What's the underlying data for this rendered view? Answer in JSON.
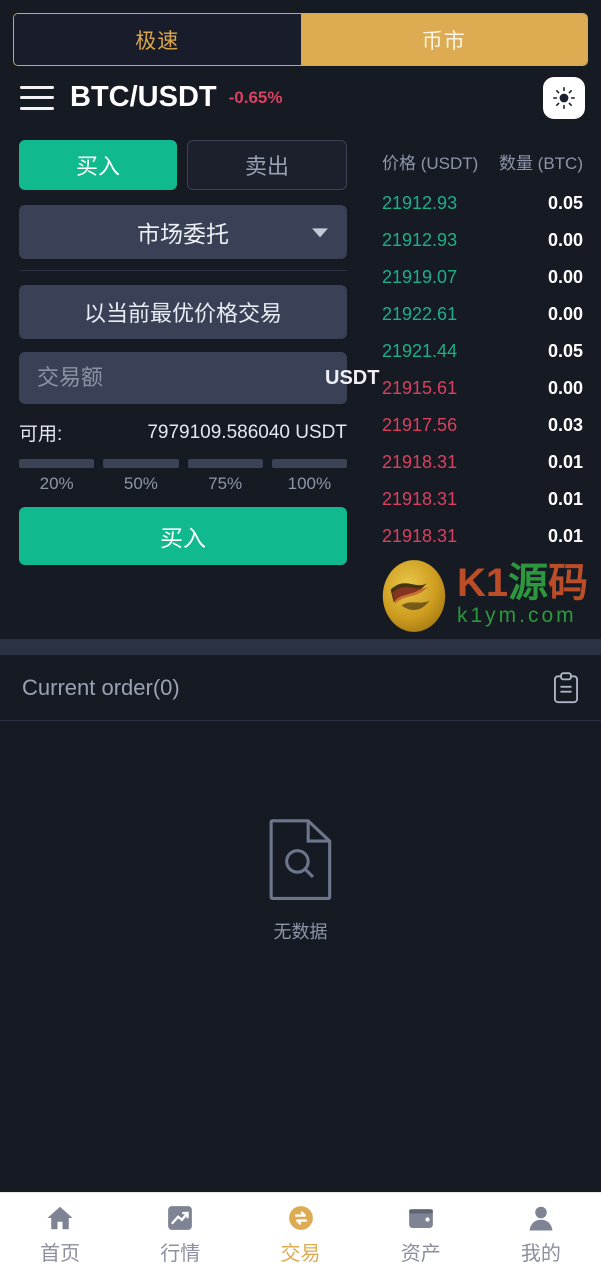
{
  "top_tabs": [
    {
      "label": "极速",
      "active": false
    },
    {
      "label": "币市",
      "active": true
    }
  ],
  "header": {
    "menu_icon": "hamburger-menu-icon",
    "pair": "BTC/USDT",
    "change": "-0.65%",
    "change_color": "#d9415f",
    "theme_icon": "sun-icon"
  },
  "order_form": {
    "side_buy_label": "买入",
    "side_sell_label": "卖出",
    "active_side": "buy",
    "order_type_label": "市场委托",
    "order_type_caret_icon": "chevron-down-icon",
    "best_price_label": "以当前最优价格交易",
    "amount_placeholder": "交易额",
    "amount_value": "",
    "amount_unit": "USDT",
    "available_label": "可用:",
    "available_value": "7979109.586040 USDT",
    "percents": [
      "20%",
      "50%",
      "75%",
      "100%"
    ],
    "submit_label": "买入"
  },
  "order_book": {
    "col_price": "价格 (USDT)",
    "col_amount": "数量 (BTC)",
    "rows": [
      {
        "price": "21912.93",
        "amount": "0.05",
        "side": "bid"
      },
      {
        "price": "21912.93",
        "amount": "0.00",
        "side": "bid"
      },
      {
        "price": "21919.07",
        "amount": "0.00",
        "side": "bid"
      },
      {
        "price": "21922.61",
        "amount": "0.00",
        "side": "bid"
      },
      {
        "price": "21921.44",
        "amount": "0.05",
        "side": "bid"
      },
      {
        "price": "21915.61",
        "amount": "0.00",
        "side": "ask"
      },
      {
        "price": "21917.56",
        "amount": "0.03",
        "side": "ask"
      },
      {
        "price": "21918.31",
        "amount": "0.01",
        "side": "ask"
      },
      {
        "price": "21918.31",
        "amount": "0.01",
        "side": "ask"
      },
      {
        "price": "21918.31",
        "amount": "0.01",
        "side": "ask"
      }
    ],
    "bid_color": "#1eae8c",
    "ask_color": "#d9415f"
  },
  "watermark": {
    "logo_icon": "yin-yang-logo-icon",
    "text_k1": "K1",
    "text_cn1": "源",
    "text_cn2": "码",
    "text_sub": "k1ym.com"
  },
  "current_order": {
    "title": "Current order(0)",
    "clipboard_icon": "clipboard-icon",
    "empty_icon": "document-search-icon",
    "empty_text": "无数据"
  },
  "bottom_nav": [
    {
      "label": "首页",
      "icon": "home-icon",
      "active": false
    },
    {
      "label": "行情",
      "icon": "chart-trend-icon",
      "active": false
    },
    {
      "label": "交易",
      "icon": "exchange-coin-icon",
      "active": true
    },
    {
      "label": "资产",
      "icon": "wallet-icon",
      "active": false
    },
    {
      "label": "我的",
      "icon": "user-icon",
      "active": false
    }
  ]
}
